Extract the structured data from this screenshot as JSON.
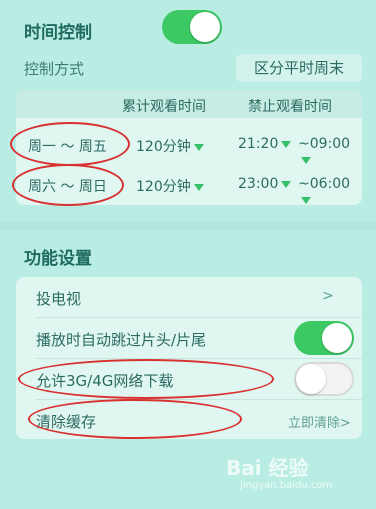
{
  "time_control": {
    "title": "时间控制",
    "enabled": true,
    "mode_label": "控制方式",
    "mode_value": "区分平时周末"
  },
  "schedule": {
    "headers": [
      "累计观看时间",
      "禁止观看时间"
    ],
    "rows": [
      {
        "days": "周一 ～ 周五",
        "duration": "120分钟",
        "start": "21:20",
        "end": "~09:00"
      },
      {
        "days": "周六 ～ 周日",
        "duration": "120分钟",
        "start": "23:00",
        "end": "~06:00"
      }
    ]
  },
  "functions": {
    "title": "功能设置",
    "items": [
      {
        "label": "投电视",
        "value": ">"
      },
      {
        "label": "播放时自动跳过片头/片尾",
        "toggle": true
      },
      {
        "label": "允许3G/4G网络下载",
        "toggle": false
      },
      {
        "label": "清除缓存",
        "value": "立即清除>"
      }
    ]
  },
  "watermark": {
    "text": "Bai 经验",
    "sub": "jingyan.baidu.com"
  }
}
